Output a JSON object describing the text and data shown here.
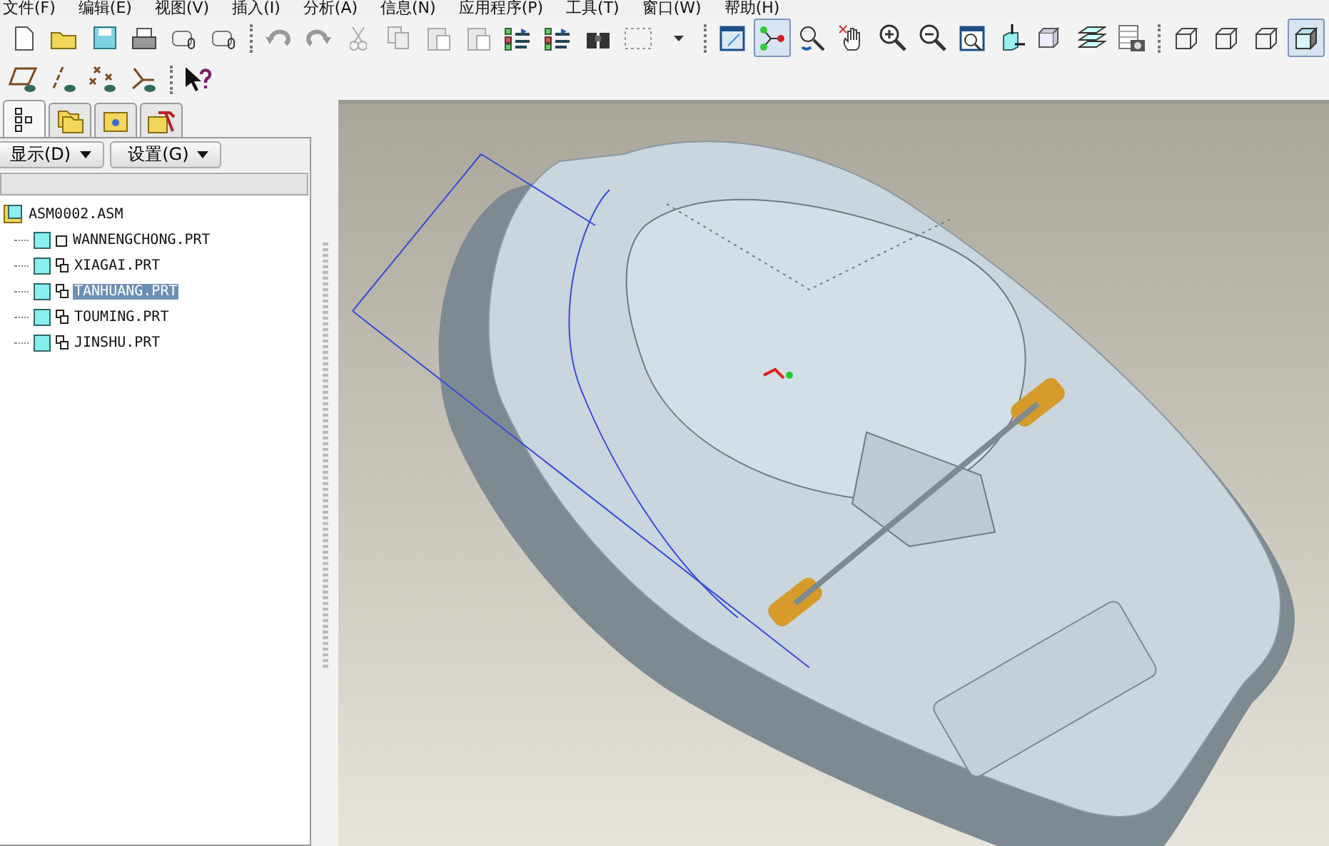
{
  "menu_bar": [
    "文件(F)",
    "编辑(E)",
    "视图(V)",
    "插入(I)",
    "分析(A)",
    "信息(N)",
    "应用程序(P)",
    "工具(T)",
    "窗口(W)",
    "帮助(H)"
  ],
  "toolbar_row_1": [
    {
      "kind": "new",
      "pressed": false
    },
    {
      "kind": "open",
      "pressed": false
    },
    {
      "kind": "save",
      "pressed": false
    },
    {
      "kind": "print",
      "pressed": false
    },
    {
      "kind": "mail",
      "pressed": false
    },
    {
      "kind": "mail",
      "pressed": false
    },
    {
      "kind": "sep"
    },
    {
      "kind": "undo",
      "pressed": false
    },
    {
      "kind": "redo",
      "pressed": false
    },
    {
      "kind": "cut",
      "pressed": false
    },
    {
      "kind": "copy",
      "pressed": false
    },
    {
      "kind": "paste",
      "pressed": false
    },
    {
      "kind": "paste",
      "pressed": false
    },
    {
      "kind": "regen",
      "pressed": false
    },
    {
      "kind": "regen",
      "pressed": false
    },
    {
      "kind": "find",
      "pressed": false
    },
    {
      "kind": "select",
      "pressed": false
    },
    {
      "kind": "dropdown",
      "pressed": false
    },
    {
      "kind": "sep"
    },
    {
      "kind": "repaint",
      "pressed": false
    },
    {
      "kind": "spin",
      "pressed": true
    },
    {
      "kind": "orient",
      "pressed": false
    },
    {
      "kind": "hand",
      "pressed": false
    },
    {
      "kind": "zoomin",
      "pressed": false
    },
    {
      "kind": "zoomout",
      "pressed": false
    },
    {
      "kind": "refit",
      "pressed": false
    },
    {
      "kind": "reorient",
      "pressed": false
    },
    {
      "kind": "views",
      "pressed": false
    },
    {
      "kind": "layers",
      "pressed": false
    },
    {
      "kind": "camera",
      "pressed": false
    },
    {
      "kind": "sep"
    },
    {
      "kind": "wire",
      "pressed": false
    },
    {
      "kind": "wire",
      "pressed": false
    },
    {
      "kind": "wire",
      "pressed": false
    },
    {
      "kind": "shade",
      "pressed": true
    }
  ],
  "toolbar_row_2": [
    {
      "kind": "plane",
      "pressed": false
    },
    {
      "kind": "axis",
      "pressed": false
    },
    {
      "kind": "point",
      "pressed": false
    },
    {
      "kind": "csys",
      "pressed": false
    },
    {
      "kind": "sep"
    },
    {
      "kind": "help",
      "pressed": false
    }
  ],
  "panel_tabs": [
    {
      "kind": "tree",
      "selected": true
    },
    {
      "kind": "folders",
      "selected": false
    },
    {
      "kind": "favorites",
      "selected": false
    },
    {
      "kind": "tools",
      "selected": false
    }
  ],
  "panel_buttons": [
    "显示(D)",
    "设置(G)"
  ],
  "model_tree": {
    "label": "ASM0002.ASM",
    "children": [
      {
        "label": "WANNENGCHONG.PRT",
        "linked": false,
        "selected": false
      },
      {
        "label": "XIAGAI.PRT",
        "linked": true,
        "selected": false
      },
      {
        "label": "TANHUANG.PRT",
        "linked": true,
        "selected": true
      },
      {
        "label": "TOUMING.PRT",
        "linked": true,
        "selected": false
      },
      {
        "label": "JINSHU.PRT",
        "linked": true,
        "selected": false
      }
    ]
  }
}
